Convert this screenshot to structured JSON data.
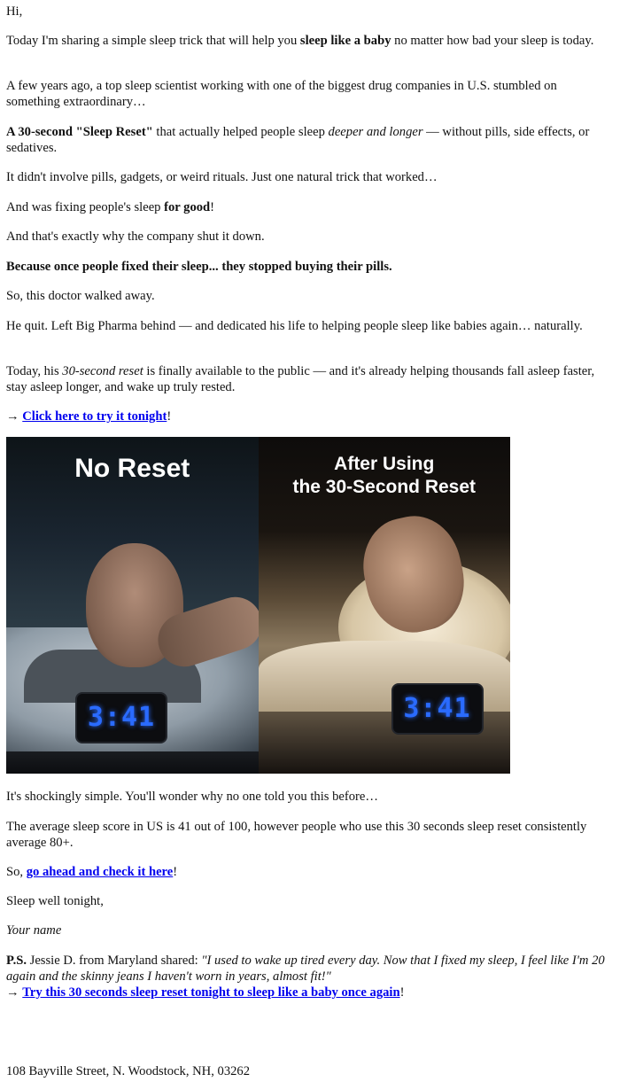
{
  "greeting": "Hi,",
  "p1": {
    "a": "Today I'm sharing a simple sleep trick that will help you ",
    "b": "sleep like a baby",
    "c": " no matter how bad your sleep is today."
  },
  "p2": "A few years ago, a top sleep scientist working with one of the biggest drug companies in U.S. stumbled on something extraordinary…",
  "p3": {
    "a": "A 30-second \"Sleep Reset\"",
    "b": " that actually helped people sleep ",
    "c": "deeper and longer",
    "d": " — without pills, side effects, or sedatives."
  },
  "p4": "It didn't involve pills, gadgets, or weird rituals. Just one natural trick that worked…",
  "p5": {
    "a": "And was fixing people's sleep ",
    "b": "for good",
    "c": "!"
  },
  "p6": "And that's exactly why the company shut it down.",
  "p7": "Because once people fixed their sleep... they stopped buying their pills.",
  "p8": "So, this doctor walked away.",
  "p9": "He quit. Left Big Pharma behind — and dedicated his life to helping people sleep like babies again… naturally.",
  "p10": {
    "a": "Today, his ",
    "b": "30-second reset",
    "c": " is finally available to the public — and it's already helping thousands fall asleep faster, stay asleep longer, and wake up truly rested."
  },
  "cta1": {
    "arrow": "→ ",
    "link": "Click here to try it tonight",
    "end": "!"
  },
  "image": {
    "left_title": "No Reset",
    "right_title_1": "After Using",
    "right_title_2": "the 30-Second Reset",
    "clock_left": "3:41",
    "clock_right": "3:41"
  },
  "p11": "It's shockingly simple. You'll wonder why no one told you this before…",
  "p12": "The average sleep score in US is 41 out of 100, however people who use this 30 seconds sleep reset consistently average 80+.",
  "cta2": {
    "pre": "So, ",
    "link": "go ahead and check it here",
    "end": "!"
  },
  "signoff": "Sleep well tonight,",
  "signature": "Your name",
  "ps": {
    "label": "P.S.",
    "a": " Jessie D. from Maryland shared: ",
    "quote": "\"I used to wake up tired every day. Now that I fixed my sleep, I feel like I'm 20 again and the skinny jeans I haven't worn in years, almost fit!\""
  },
  "cta3": {
    "arrow": "→ ",
    "link": "Try this 30 seconds sleep reset tonight to sleep like a baby once again",
    "end": "!"
  },
  "address": "108 Bayville Street, N. Woodstock, NH, 03262"
}
